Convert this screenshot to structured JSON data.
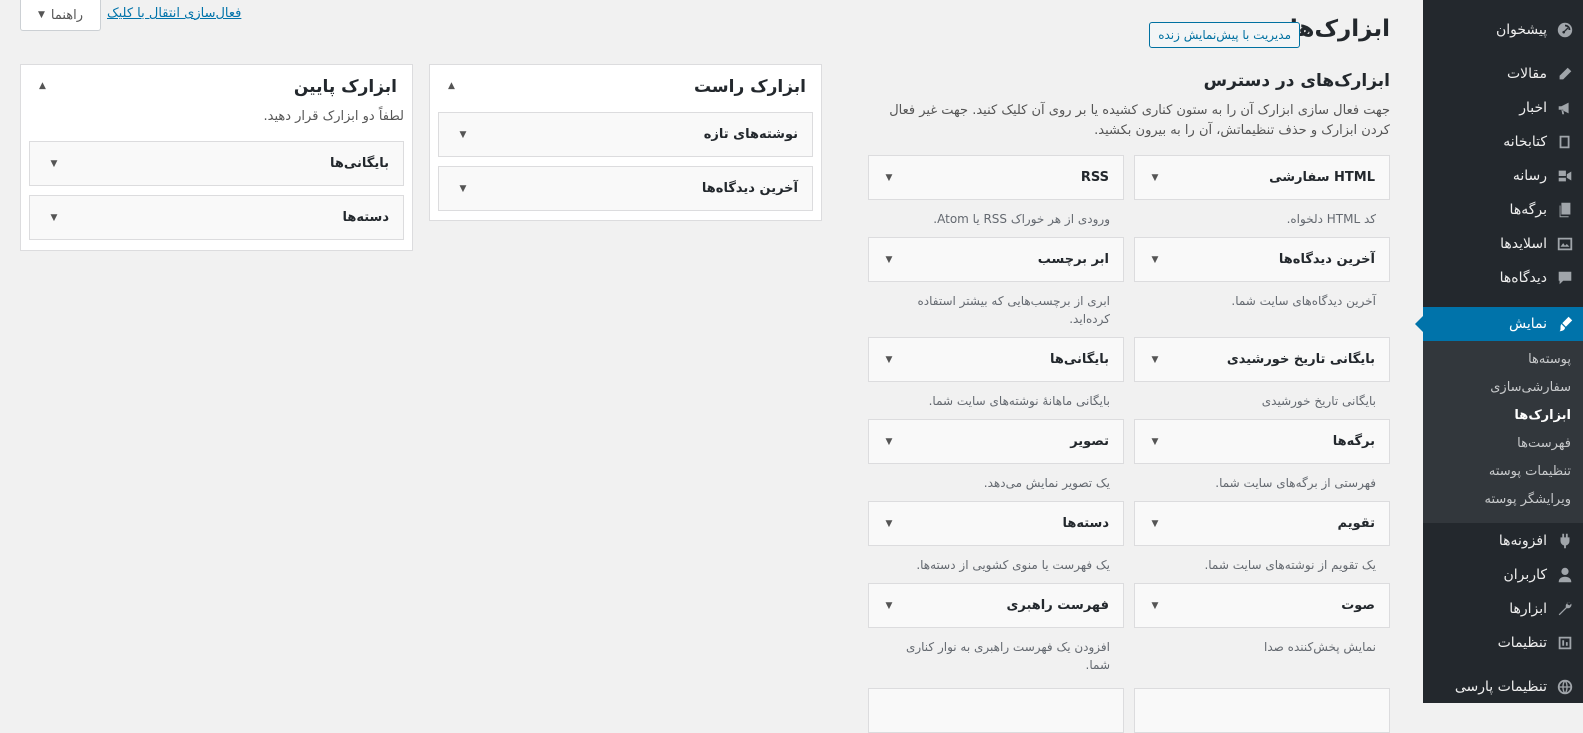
{
  "admin_menu": {
    "items": [
      {
        "label": "پیشخوان",
        "icon": "dashboard-icon"
      },
      {
        "label": "مقالات",
        "icon": "pen-icon"
      },
      {
        "label": "اخبار",
        "icon": "megaphone-icon"
      },
      {
        "label": "کتابخانه",
        "icon": "book-icon"
      },
      {
        "label": "رسانه",
        "icon": "media-icon"
      },
      {
        "label": "برگه‌ها",
        "icon": "pages-icon"
      },
      {
        "label": "اسلایدها",
        "icon": "slides-icon"
      },
      {
        "label": "دیدگاه‌ها",
        "icon": "comment-icon"
      },
      {
        "label": "نمایش",
        "icon": "brush-icon",
        "current": true
      },
      {
        "label": "افزونه‌ها",
        "icon": "plugin-icon"
      },
      {
        "label": "کاربران",
        "icon": "user-icon"
      },
      {
        "label": "ابزارها",
        "icon": "wrench-icon"
      },
      {
        "label": "تنظیمات",
        "icon": "settings-icon"
      },
      {
        "label": "تنظیمات پارسی",
        "icon": "globe-icon"
      }
    ],
    "submenu": [
      {
        "label": "پوسته‌ها"
      },
      {
        "label": "سفارشی‌سازی"
      },
      {
        "label": "ابزارک‌ها",
        "current": true
      },
      {
        "label": "فهرست‌ها"
      },
      {
        "label": "تنظیمات پوسته"
      },
      {
        "label": "ویرایشگر پوسته"
      }
    ]
  },
  "header": {
    "title": "ابزارک‌ها",
    "live_preview_label": "مدیریت با پیش‌نمایش زنده",
    "help_label": "راهنما",
    "accessibility_link": "فعال‌سازی انتقال با کلیک"
  },
  "available": {
    "title": "ابزارک‌های در دسترس",
    "description": "جهت فعال سازی ابزارک آن را به ستون کناری کشیده یا بر روی آن کلیک کنید. جهت غیر فعال کردن ابزارک و حذف تنظیماتش، آن را به بیرون بکشید.",
    "widgets": [
      {
        "title": "HTML سفارشی",
        "desc": "کد HTML دلخواه."
      },
      {
        "title": "RSS",
        "desc": "ورودی از هر خوراک RSS یا Atom."
      },
      {
        "title": "آخرین دیدگاه‌ها",
        "desc": "آخرین دیدگاه‌های سایت شما."
      },
      {
        "title": "ابر برچسب",
        "desc": "ابری از برچسب‌هایی که بیشتر استفاده کرده‌اید."
      },
      {
        "title": "بایگانی تاریخ خورشیدی",
        "desc": "بایگانی تاریخ خورشیدی"
      },
      {
        "title": "بایگانی‌ها",
        "desc": "بایگانی ماهانهٔ نوشته‌های سایت شما."
      },
      {
        "title": "برگه‌ها",
        "desc": "فهرستی از برگه‌های سایت شما."
      },
      {
        "title": "تصویر",
        "desc": "یک تصویر نمایش می‌دهد."
      },
      {
        "title": "تقویم",
        "desc": "یک تقویم از نوشته‌های سایت شما."
      },
      {
        "title": "دسته‌ها",
        "desc": "یک فهرست یا منوی کشویی از دسته‌ها."
      },
      {
        "title": "صوت",
        "desc": "نمایش پخش‌کننده صدا"
      },
      {
        "title": "فهرست راهبری",
        "desc": "افزودن یک فهرست راهبری به نوار کناری شما."
      }
    ]
  },
  "sidebars": {
    "right": {
      "title": "ابزارک راست",
      "widgets": [
        {
          "title": "نوشته‌های تازه"
        },
        {
          "title": "آخرین دیدگاه‌ها"
        }
      ]
    },
    "bottom": {
      "title": "ابزارک پایین",
      "description": "لطفاً دو ابزارک قرار دهید.",
      "widgets": [
        {
          "title": "بایگانی‌ها"
        },
        {
          "title": "دسته‌ها"
        }
      ]
    }
  },
  "colors": {
    "menu_bg": "#23282d",
    "accent": "#0073aa",
    "submenu_bg": "#32373c"
  }
}
